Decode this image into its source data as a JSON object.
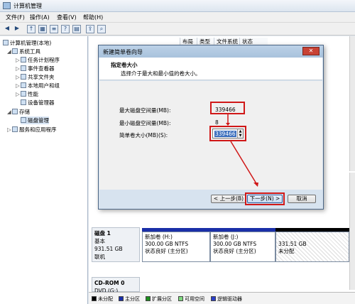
{
  "window": {
    "title": "计算机管理"
  },
  "menu": [
    "文件(F)",
    "操作(A)",
    "查看(V)",
    "帮助(H)"
  ],
  "tree": [
    {
      "label": "计算机管理(本地)",
      "indent": 0,
      "tri": ""
    },
    {
      "label": "系统工具",
      "indent": 1,
      "tri": "◢"
    },
    {
      "label": "任务计划程序",
      "indent": 2,
      "tri": "▷"
    },
    {
      "label": "事件查看器",
      "indent": 2,
      "tri": "▷"
    },
    {
      "label": "共享文件夹",
      "indent": 2,
      "tri": "▷"
    },
    {
      "label": "本地用户和组",
      "indent": 2,
      "tri": "▷"
    },
    {
      "label": "性能",
      "indent": 2,
      "tri": "▷"
    },
    {
      "label": "设备管理器",
      "indent": 2,
      "tri": ""
    },
    {
      "label": "存储",
      "indent": 1,
      "tri": "◢"
    },
    {
      "label": "磁盘管理",
      "indent": 2,
      "tri": ""
    },
    {
      "label": "服务和应用程序",
      "indent": 1,
      "tri": "▷"
    }
  ],
  "columns": [
    "布局",
    "类型",
    "文件系统",
    "状态"
  ],
  "wizard": {
    "title": "新建简单卷向导",
    "heading": "指定卷大小",
    "subheading": "选择介于最大和最小值的卷大小。",
    "max_label": "最大磁盘空间量(MB):",
    "max_value": "339466",
    "min_label": "最小磁盘空间量(MB):",
    "min_value": "8",
    "size_label": "简单卷大小(MB)(S):",
    "size_value": "339466",
    "back": "< 上一步(B)",
    "next": "下一步(N) >",
    "cancel": "取消"
  },
  "disk1": {
    "name": "磁盘 1",
    "type": "基本",
    "size": "931.51 GB",
    "status": "联机"
  },
  "partitions": [
    {
      "name": "新加卷 (H:)",
      "size": "300.00 GB NTFS",
      "status": "状态良好 (主分区)"
    },
    {
      "name": "新加卷 (J:)",
      "size": "300.00 GB NTFS",
      "status": "状态良好 (主分区)"
    },
    {
      "name": "",
      "size": "331.51 GB",
      "status": "未分配"
    }
  ],
  "cdrom": {
    "name": "CD-ROM 0",
    "type": "DVD (G:)"
  },
  "legend": [
    {
      "label": "未分配",
      "color": "#000000"
    },
    {
      "label": "主分区",
      "color": "#1a2fa8"
    },
    {
      "label": "扩展分区",
      "color": "#1e8f1e"
    },
    {
      "label": "可用空间",
      "color": "#7fd87f"
    },
    {
      "label": "逻辑驱动器",
      "color": "#2b3fc9"
    }
  ]
}
